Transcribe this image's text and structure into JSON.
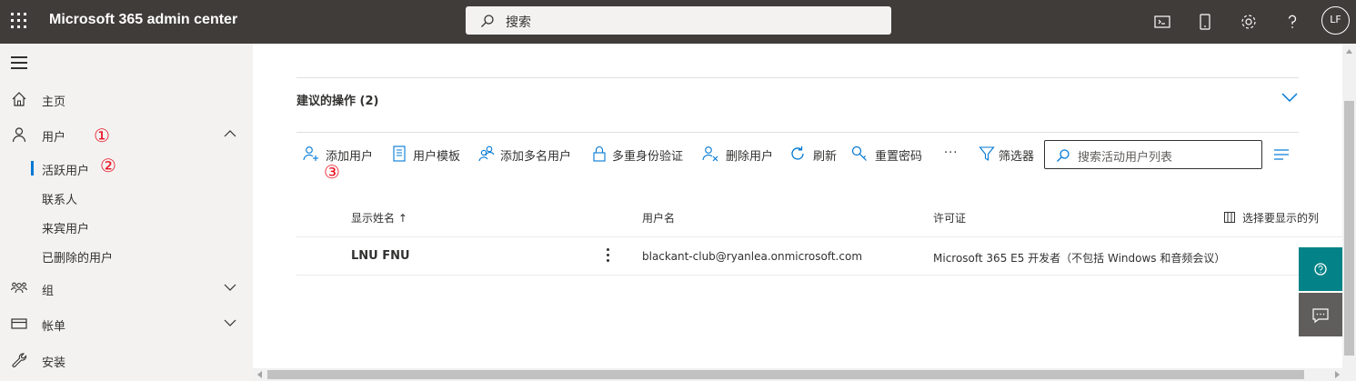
{
  "app": {
    "title": "Microsoft 365 admin center"
  },
  "search": {
    "placeholder": "搜索"
  },
  "user": {
    "initials": "LF"
  },
  "nav": {
    "home": "主页",
    "users": "用户",
    "users_sub": [
      "活跃用户",
      "联系人",
      "来宾用户",
      "已删除的用户"
    ],
    "groups": "组",
    "billing": "帐单",
    "setup": "安装"
  },
  "annotations": {
    "n1": "①",
    "n2": "②",
    "n3": "③"
  },
  "recommended": {
    "title": "建议的操作 (2)"
  },
  "toolbar": {
    "add_user": "添加用户",
    "user_templates": "用户模板",
    "add_multiple": "添加多名用户",
    "mfa": "多重身份验证",
    "delete_user": "删除用户",
    "refresh": "刷新",
    "reset_password": "重置密码",
    "more": "···",
    "filter": "筛选器",
    "search_placeholder": "搜索活动用户列表"
  },
  "table": {
    "headers": {
      "display_name": "显示姓名 ↑",
      "username": "用户名",
      "license": "许可证",
      "choose_columns": "选择要显示的列"
    },
    "rows": [
      {
        "display_name": "LNU FNU",
        "username": "blackant-club@ryanlea.onmicrosoft.com",
        "license": "Microsoft 365 E5 开发者（不包括 Windows 和音频会议）"
      }
    ]
  },
  "colors": {
    "topbar": "#403c3a",
    "accent": "#0078d4",
    "help_fab": "#038387",
    "annotation": "#e81123"
  }
}
